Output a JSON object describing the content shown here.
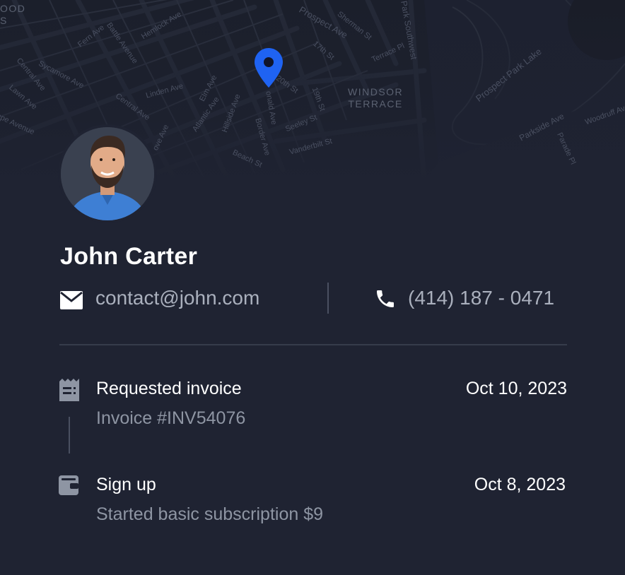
{
  "map": {
    "streets": [
      "Fern Ave",
      "Battle Avenue",
      "Hemlock Ave",
      "Prospect Ave",
      "17th St",
      "Sherman St",
      "Terrace Pl",
      "Park Southwest",
      "Sycamore Ave",
      "Central Ave",
      "Linden Ave",
      "Elm Ave",
      "20th St",
      "19th St",
      "Seeley St",
      "Prospect Park Lake",
      "Lawn Ave",
      "Central Ave",
      "Hillside Ave",
      "Atlantic Ave",
      "onald Ave",
      "Border Ave",
      "Vanderbilt St",
      "Parkside Ave",
      "Woodruff Ave",
      "ape Avenue",
      "ove Ave",
      "Beach St",
      "Parade Pl"
    ],
    "district": "WINDSOR\nTERRACE",
    "corner_label": "OOD\nS"
  },
  "profile": {
    "name": "John Carter",
    "email": "contact@john.com",
    "phone": "(414) 187 - 0471"
  },
  "activity": [
    {
      "title": "Requested invoice",
      "subtitle": "Invoice #INV54076",
      "date": "Oct 10, 2023",
      "icon": "invoice-icon"
    },
    {
      "title": "Sign up",
      "subtitle": "Started basic subscription $9",
      "date": "Oct 8, 2023",
      "icon": "wallet-icon"
    }
  ],
  "colors": {
    "background": "#1f2332",
    "pin": "#1f63f2",
    "muted_text": "#aab0bd"
  }
}
